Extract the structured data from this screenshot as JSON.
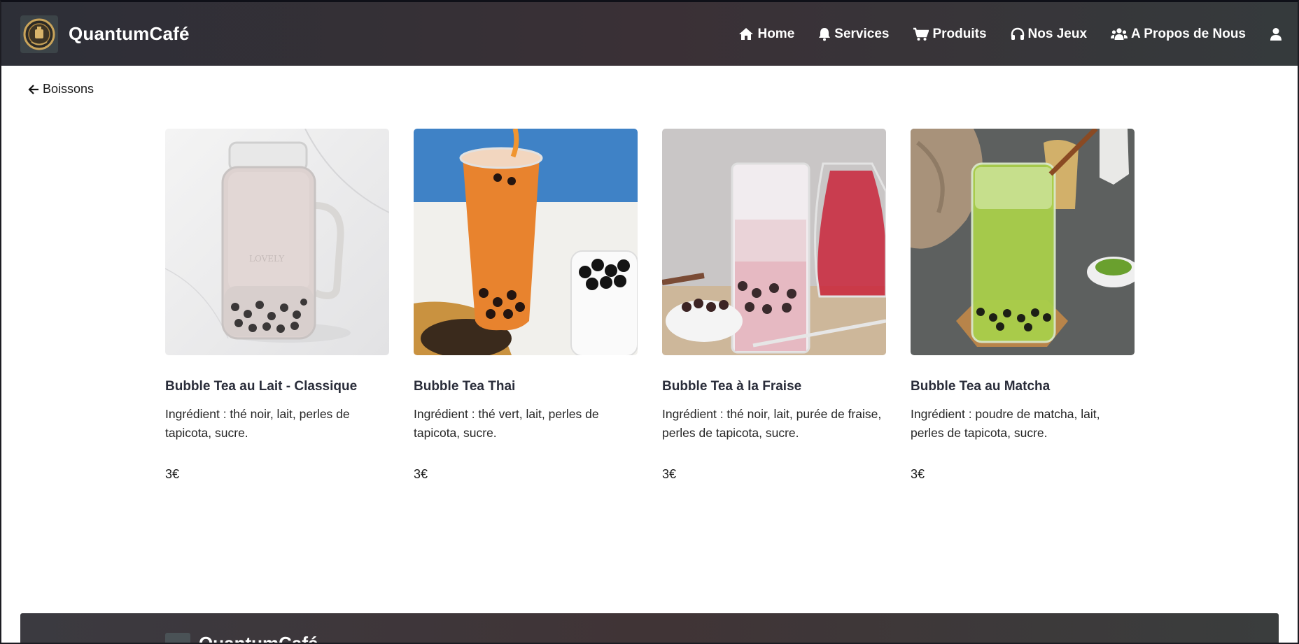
{
  "navbar": {
    "brand_name": "QuantumCafé",
    "logo_icon": "coffee-crest-logo",
    "links": [
      {
        "label": "Home",
        "icon": "home-icon"
      },
      {
        "label": "Services",
        "icon": "bell-icon"
      },
      {
        "label": "Produits",
        "icon": "cart-icon"
      },
      {
        "label": "Nos Jeux",
        "icon": "headphones-icon"
      },
      {
        "label": "A Propos de Nous",
        "icon": "users-icon"
      }
    ],
    "user_icon": "user-icon"
  },
  "back_link": {
    "label": "Boissons",
    "icon": "arrow-left-icon"
  },
  "products": [
    {
      "title": "Bubble Tea au Lait - Classique",
      "description": "Ingrédient : thé noir, lait, perles de tapicota, sucre.",
      "price": "3€"
    },
    {
      "title": "Bubble Tea Thai",
      "description": "Ingrédient : thé vert, lait, perles de tapicota, sucre.",
      "price": "3€"
    },
    {
      "title": "Bubble Tea à la Fraise",
      "description": "Ingrédient : thé noir, lait, purée de fraise, perles de tapicota, sucre.",
      "price": "3€"
    },
    {
      "title": "Bubble Tea au Matcha",
      "description": "Ingrédient : poudre de matcha, lait, perles de tapicota, sucre.",
      "price": "3€"
    }
  ],
  "footer": {
    "brand_name": "QuantumCafé"
  },
  "colors": {
    "navbar": "#2f3036",
    "footer": "#3d3a3e",
    "text": "#212529"
  }
}
